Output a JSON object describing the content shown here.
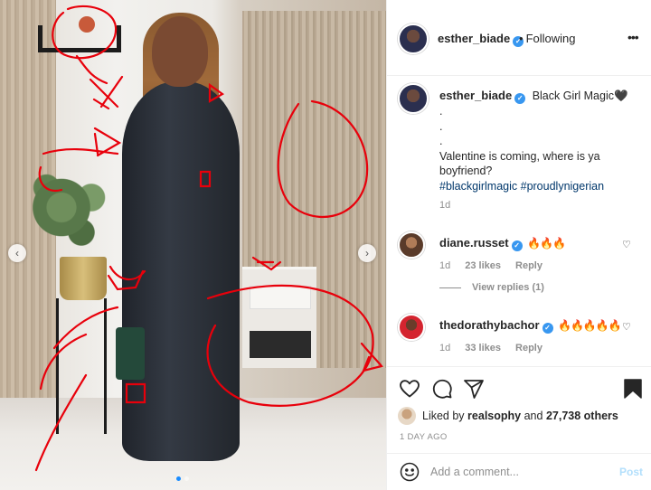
{
  "post": {
    "author": "esther_biade",
    "follow_status": "Following",
    "caption": {
      "title": "Black Girl Magic",
      "heart": "🖤",
      "dots": [
        ".",
        ".",
        "."
      ],
      "body": "Valentine is coming, where is ya boyfriend?",
      "hashtags": "#blackgirlmagic #proudlynigerian",
      "age": "1d"
    },
    "comments": [
      {
        "user": "diane.russet",
        "text": "🔥🔥🔥",
        "age": "1d",
        "likes": "23 likes",
        "reply_label": "Reply"
      },
      {
        "user": "thedorathybachor",
        "text": "🔥🔥🔥🔥🔥",
        "age": "1d",
        "likes": "33 likes",
        "reply_label": "Reply"
      }
    ],
    "view_replies": "View replies (1)",
    "liked_by": {
      "prefix": "Liked by",
      "user": "realsophy",
      "connector": "and",
      "others": "27,738 others"
    },
    "timestamp": "1 DAY AGO",
    "comment_box": {
      "placeholder": "Add a comment...",
      "post_label": "Post"
    }
  },
  "carousel": {
    "prev": "‹",
    "next": "›",
    "slide_count": 2,
    "active_slide": 1
  },
  "icons": {
    "verified": "✓",
    "more": "•••",
    "dot": "•",
    "heart_small": "♡"
  },
  "colors": {
    "verified": "#3897f0",
    "hashtag": "#00376b",
    "post_disabled": "#b2dffc",
    "active_dot": "#1a8cff",
    "annotation": "#e8000b"
  }
}
